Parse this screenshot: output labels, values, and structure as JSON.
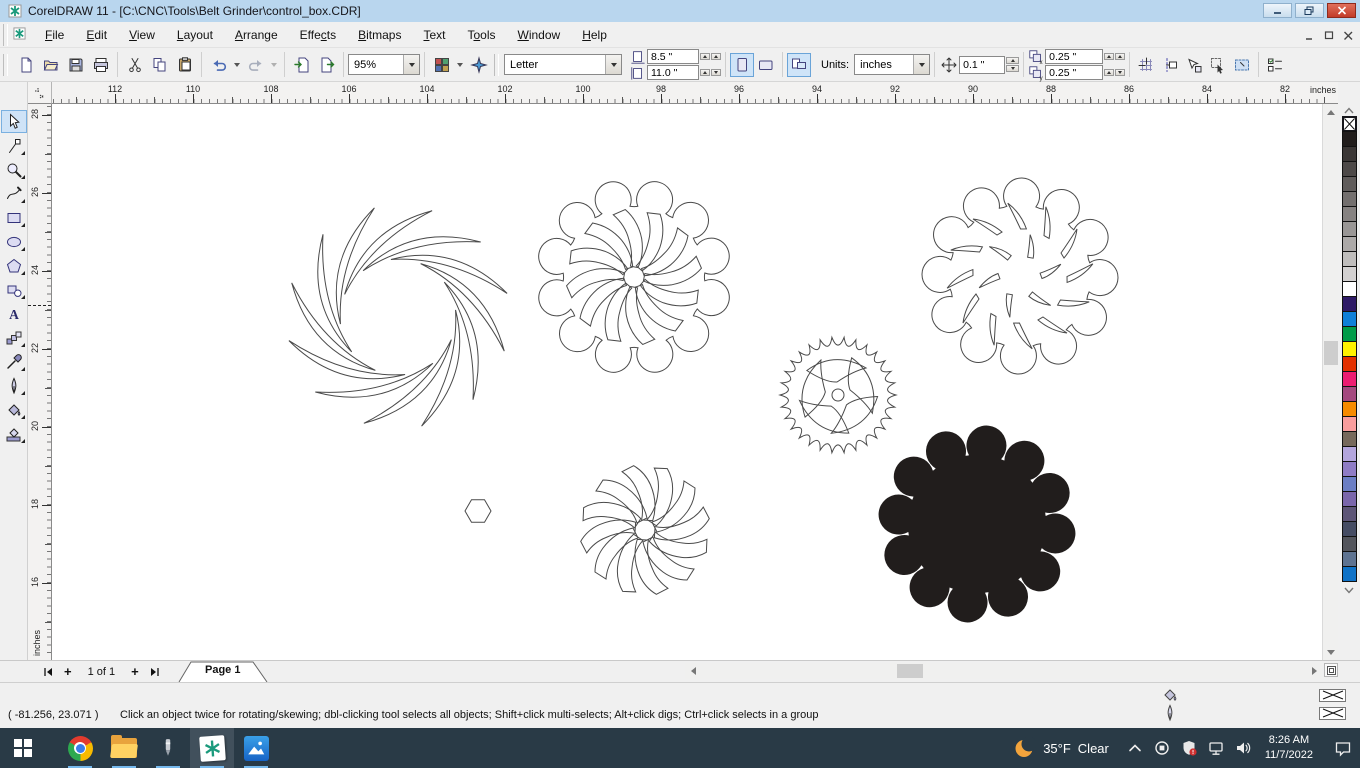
{
  "window": {
    "title": "CorelDRAW 11 - [C:\\CNC\\Tools\\Belt Grinder\\control_box.CDR]"
  },
  "menu": {
    "items": [
      {
        "label": "File",
        "accel": 0
      },
      {
        "label": "Edit",
        "accel": 0
      },
      {
        "label": "View",
        "accel": 0
      },
      {
        "label": "Layout",
        "accel": 0
      },
      {
        "label": "Arrange",
        "accel": 0
      },
      {
        "label": "Effects",
        "accel": 4
      },
      {
        "label": "Bitmaps",
        "accel": 0
      },
      {
        "label": "Text",
        "accel": 0
      },
      {
        "label": "Tools",
        "accel": 1
      },
      {
        "label": "Window",
        "accel": 0
      },
      {
        "label": "Help",
        "accel": 0
      }
    ]
  },
  "standard_toolbar": {
    "icons": [
      "new",
      "open",
      "save",
      "print",
      "cut",
      "copy",
      "paste",
      "undo",
      "redo",
      "import",
      "export"
    ],
    "zoom_value": "95%",
    "launcher_icons": [
      "application-launcher",
      "corel-graphics"
    ]
  },
  "property_bar": {
    "paper_type": "Letter",
    "paper_width": "8.5 \"",
    "paper_height": "11.0 \"",
    "orientation_icons": [
      "portrait",
      "landscape"
    ],
    "all_pages_icon": "set-for-all-pages",
    "units_label": "Units:",
    "units_value": "inches",
    "nudge_value": "0.1 \"",
    "duplicate_x": "0.25 \"",
    "duplicate_y": "0.25 \"",
    "snap_icons": [
      "snap-to-grid",
      "snap-to-guidelines",
      "snap-to-objects"
    ],
    "extra_icons": [
      "treat-as-filled",
      "marquee-select",
      "options"
    ]
  },
  "ruler": {
    "h_labels": [
      "112",
      "110",
      "108",
      "106",
      "104",
      "102",
      "100",
      "98",
      "96",
      "94",
      "92",
      "90",
      "88",
      "86",
      "84",
      "82"
    ],
    "v_labels": [
      "28",
      "26",
      "24",
      "22",
      "20",
      "18",
      "16"
    ],
    "unit": "inches"
  },
  "toolbox": {
    "tools": [
      {
        "name": "pick",
        "selected": true,
        "flyout": false
      },
      {
        "name": "shape",
        "selected": false,
        "flyout": true
      },
      {
        "name": "zoom",
        "selected": false,
        "flyout": true
      },
      {
        "name": "freehand",
        "selected": false,
        "flyout": true
      },
      {
        "name": "rectangle",
        "selected": false,
        "flyout": true
      },
      {
        "name": "ellipse",
        "selected": false,
        "flyout": true
      },
      {
        "name": "polygon",
        "selected": false,
        "flyout": true
      },
      {
        "name": "basic-shapes",
        "selected": false,
        "flyout": true
      },
      {
        "name": "text",
        "selected": false,
        "flyout": false
      },
      {
        "name": "interactive-blend",
        "selected": false,
        "flyout": true
      },
      {
        "name": "eyedropper",
        "selected": false,
        "flyout": true
      },
      {
        "name": "outline",
        "selected": false,
        "flyout": true
      },
      {
        "name": "fill",
        "selected": false,
        "flyout": true
      },
      {
        "name": "interactive-fill",
        "selected": false,
        "flyout": true
      }
    ]
  },
  "palette": {
    "no_fill_selected": true,
    "colors": [
      "#211d1c",
      "#3a3635",
      "#4d4948",
      "#605c5b",
      "#736f6e",
      "#868281",
      "#999695",
      "#aca9a8",
      "#bfbdbc",
      "#d2d0d0",
      "#ffffff",
      "#2e1a66",
      "#0d7fd8",
      "#009b48",
      "#fff200",
      "#e33000",
      "#ec1c71",
      "#a4487f",
      "#f68b00",
      "#f89d9d",
      "#76695c",
      "#b3a5dd",
      "#8f7cc5",
      "#6b7ec4",
      "#7a66ab",
      "#5d5577",
      "#454c63",
      "#53555c",
      "#5e7391",
      "#0f72c7"
    ]
  },
  "page_bar": {
    "page_indicator": "1 of 1",
    "page_tab": "Page 1"
  },
  "status_bar": {
    "coords": "( -81.256, 23.071 )",
    "hint": "Click an object twice for rotating/skewing; dbl-clicking tool selects all objects; Shift+click multi-selects; Alt+click digs; Ctrl+click selects in a group",
    "fill_indicator": "none",
    "outline_indicator": "none"
  },
  "taskbar": {
    "apps": [
      "start",
      "chrome",
      "file-explorer",
      "pen",
      "coreldraw",
      "photos"
    ],
    "weather_temp": "35°F",
    "weather_desc": "Clear",
    "tray_icons": [
      "chevron-up",
      "tray-app",
      "security-shield",
      "network",
      "volume"
    ],
    "time": "8:26 AM",
    "date": "11/7/2022"
  },
  "colors": {
    "titlebar_bg": "#b9d6ee",
    "taskbar_bg": "#293a46",
    "running_underline": "#76b9ed",
    "canvas_bg": "#ffffff",
    "object_fill_black": "#211d1c"
  }
}
